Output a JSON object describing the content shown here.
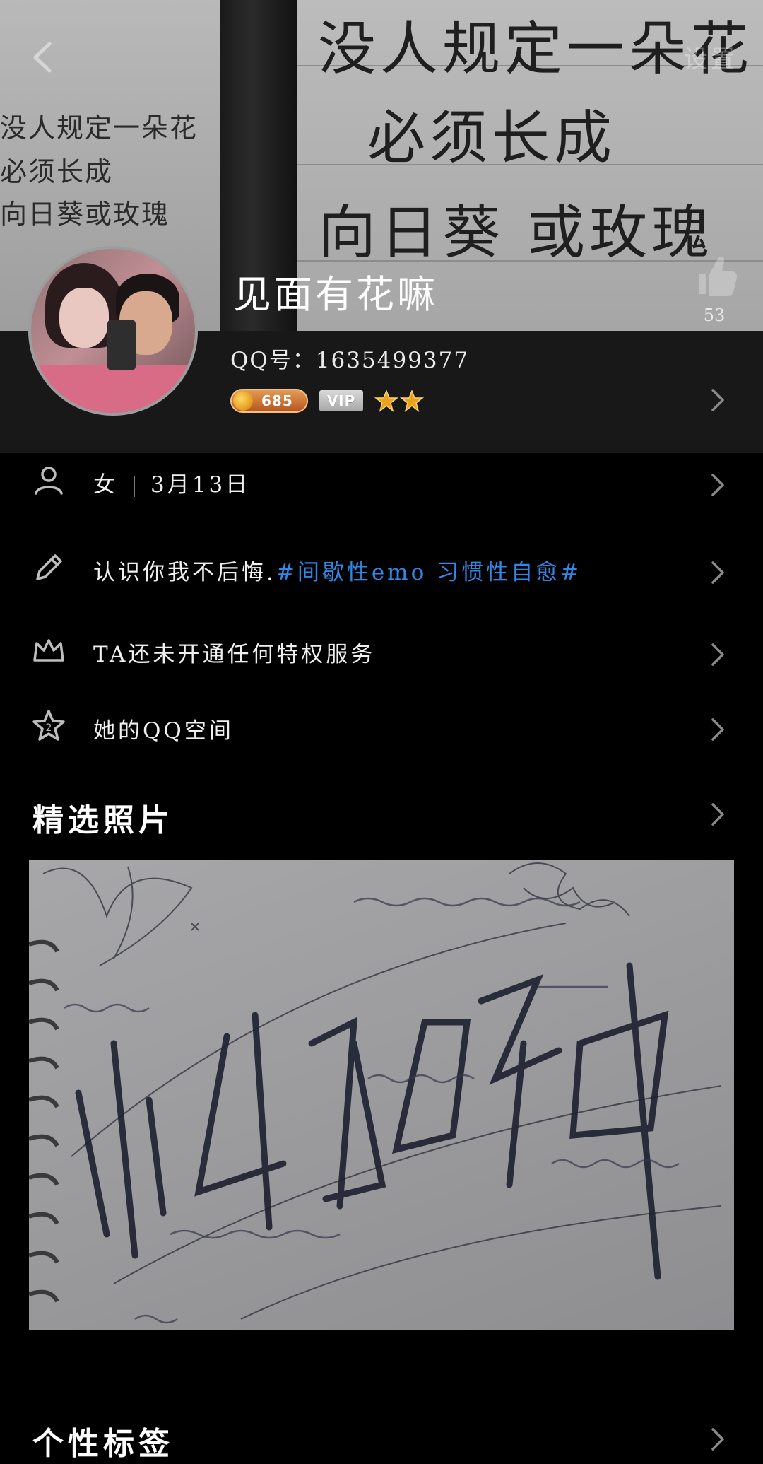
{
  "header": {
    "settings_label": "设置",
    "like_count": "53"
  },
  "cover": {
    "left_note_lines": [
      "没人规定一朵花",
      "必须长成",
      "向日葵或玫瑰"
    ],
    "right_note_lines": [
      "没人规定一朵花",
      "必须长成",
      "向日葵 或玫瑰"
    ]
  },
  "profile": {
    "nickname": "见面有花嘛",
    "qq_line": "QQ号：1635499377",
    "coin_value": "685",
    "vip_label": "VIP",
    "star_count": 2
  },
  "rows": {
    "basic_info": {
      "gender": "女",
      "birthday": "3月13日"
    },
    "signature": {
      "text": "认识你我不后悔.",
      "topic": "#间歇性emo 习惯性自愈#"
    },
    "privilege": {
      "label": "TA还未开通任何特权服务"
    },
    "qzone": {
      "label": "她的QQ空间"
    }
  },
  "sections": {
    "featured_photos_title": "精选照片",
    "tags_title": "个性标签"
  },
  "colors": {
    "link": "#2f87e6",
    "profile_band": "#181818",
    "background": "#000000"
  }
}
